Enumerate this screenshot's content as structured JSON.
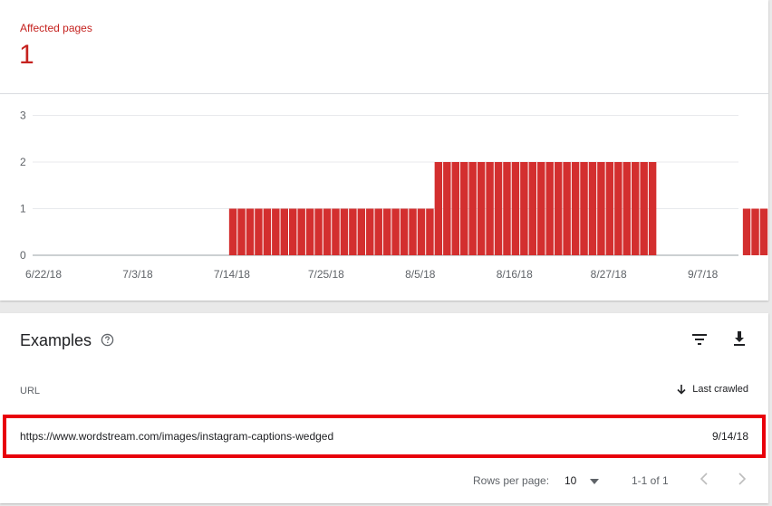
{
  "summary": {
    "affected_label": "Affected pages",
    "affected_value": "1"
  },
  "chart_data": {
    "type": "bar",
    "color": "#d32f2f",
    "ylim": [
      0,
      3
    ],
    "y_ticks": [
      "0",
      "1",
      "2",
      "3"
    ],
    "x_ticks": [
      "6/22/18",
      "7/3/18",
      "7/14/18",
      "7/25/18",
      "8/5/18",
      "8/16/18",
      "8/27/18",
      "9/7/18"
    ],
    "start_date": "6/22/18",
    "values": [
      0,
      0,
      0,
      0,
      0,
      0,
      0,
      0,
      0,
      0,
      0,
      0,
      0,
      0,
      0,
      0,
      0,
      0,
      0,
      0,
      0,
      0,
      0,
      1,
      1,
      1,
      1,
      1,
      1,
      1,
      1,
      1,
      1,
      1,
      1,
      1,
      1,
      1,
      1,
      1,
      1,
      1,
      1,
      1,
      1,
      1,
      1,
      2,
      2,
      2,
      2,
      2,
      2,
      2,
      2,
      2,
      2,
      2,
      2,
      2,
      2,
      2,
      2,
      2,
      2,
      2,
      2,
      2,
      2,
      2,
      2,
      2,
      2,
      0,
      0,
      0,
      0,
      0,
      0,
      0,
      0,
      0,
      0,
      1,
      1,
      1,
      1,
      1,
      1
    ]
  },
  "examples": {
    "title": "Examples",
    "help_icon": "help-circle-icon",
    "filter_icon": "filter-icon",
    "download_icon": "download-icon",
    "col_url": "URL",
    "col_last_crawled": "Last crawled",
    "rows": [
      {
        "url": "https://www.wordstream.com/images/instagram-captions-wedged",
        "last_crawled": "9/14/18"
      }
    ],
    "rows_per_page_label": "Rows per page:",
    "rows_per_page_value": "10",
    "range_text": "1-1 of 1"
  },
  "colors": {
    "accent": "#c5221f",
    "bar": "#d32f2f",
    "highlight": "#e8000b"
  }
}
